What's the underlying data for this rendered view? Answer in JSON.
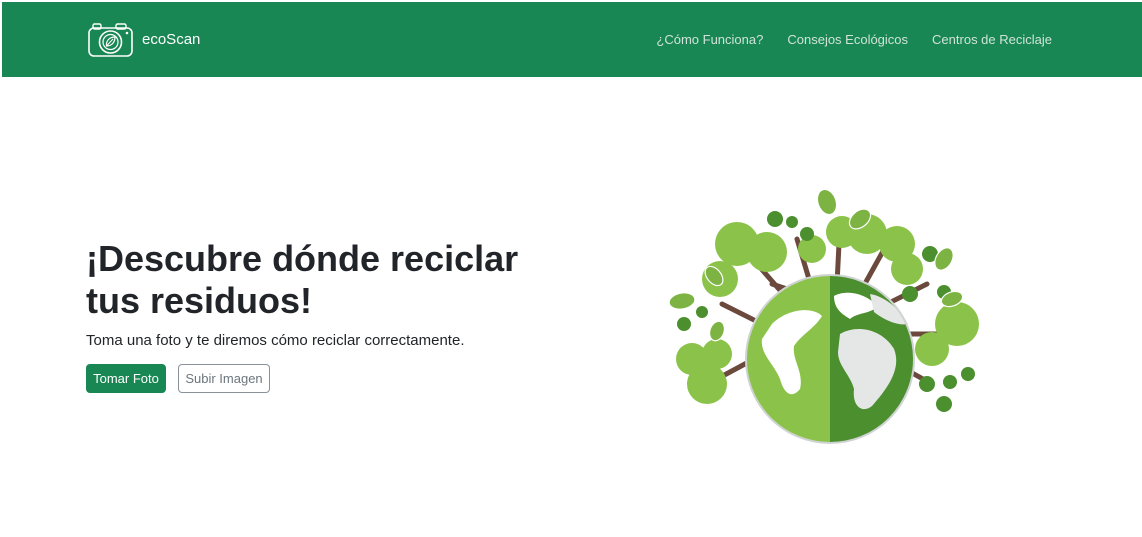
{
  "navbar": {
    "brand_name": "ecoScan",
    "brand_icon": "camera-leaf-icon",
    "bg_color": "#198754",
    "links": [
      {
        "label": "¿Cómo Funciona?"
      },
      {
        "label": "Consejos Ecológicos"
      },
      {
        "label": "Centros de Reciclaje"
      }
    ]
  },
  "hero": {
    "title": "¡Descubre dónde reciclar tus residuos!",
    "subtitle": "Toma una foto y te diremos cómo reciclar correctamente.",
    "primary_button": "Tomar Foto",
    "secondary_button": "Subir Imagen",
    "illustration": "globe-with-trees-illustration"
  },
  "colors": {
    "accent": "#198754",
    "leaf_light": "#8bc34a",
    "leaf_dark": "#4b8f2f",
    "trunk": "#6b4a3d"
  }
}
